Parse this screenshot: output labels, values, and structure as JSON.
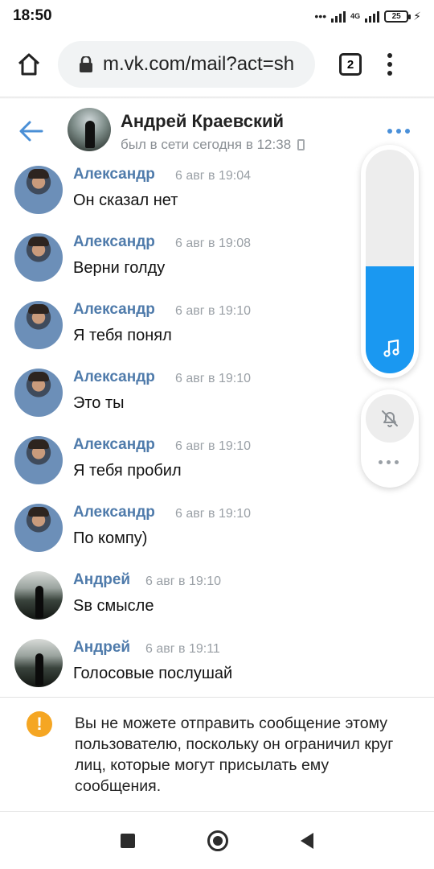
{
  "status_bar": {
    "time": "18:50",
    "network": "4G",
    "battery": "25"
  },
  "browser": {
    "url": "m.vk.com/mail?act=sh",
    "tab_count": "2"
  },
  "chat": {
    "name": "Андрей Краевский",
    "status": "был в сети сегодня в 12:38"
  },
  "messages": [
    {
      "author": "Александр",
      "time": "6 авг в 19:04",
      "text": "Он сказал нет",
      "avatar": "alex"
    },
    {
      "author": "Александр",
      "time": "6 авг в 19:08",
      "text": "Верни голду",
      "avatar": "alex"
    },
    {
      "author": "Александр",
      "time": "6 авг в 19:10",
      "text": "Я тебя понял",
      "avatar": "alex"
    },
    {
      "author": "Александр",
      "time": "6 авг в 19:10",
      "text": "Это ты",
      "avatar": "alex"
    },
    {
      "author": "Александр",
      "time": "6 авг в 19:10",
      "text": "Я тебя пробил",
      "avatar": "alex"
    },
    {
      "author": "Александр",
      "time": "6 авг в 19:10",
      "text": "По компу)",
      "avatar": "alex"
    },
    {
      "author": "Андрей",
      "time": "6 авг в 19:10",
      "text": "Sв смысле",
      "avatar": "andr"
    },
    {
      "author": "Андрей",
      "time": "6 авг в 19:11",
      "text": "Голосовые послушай",
      "avatar": "andr"
    }
  ],
  "audio_player": {
    "progress_percent": 48
  },
  "notice": {
    "text": "Вы не можете отправить сообщение этому пользователю, поскольку он ограничил круг лиц, которые могут присылать ему сообщения."
  },
  "colors": {
    "accent": "#4f7bab",
    "player_fill": "#1a98f1",
    "warning": "#f5a623"
  }
}
